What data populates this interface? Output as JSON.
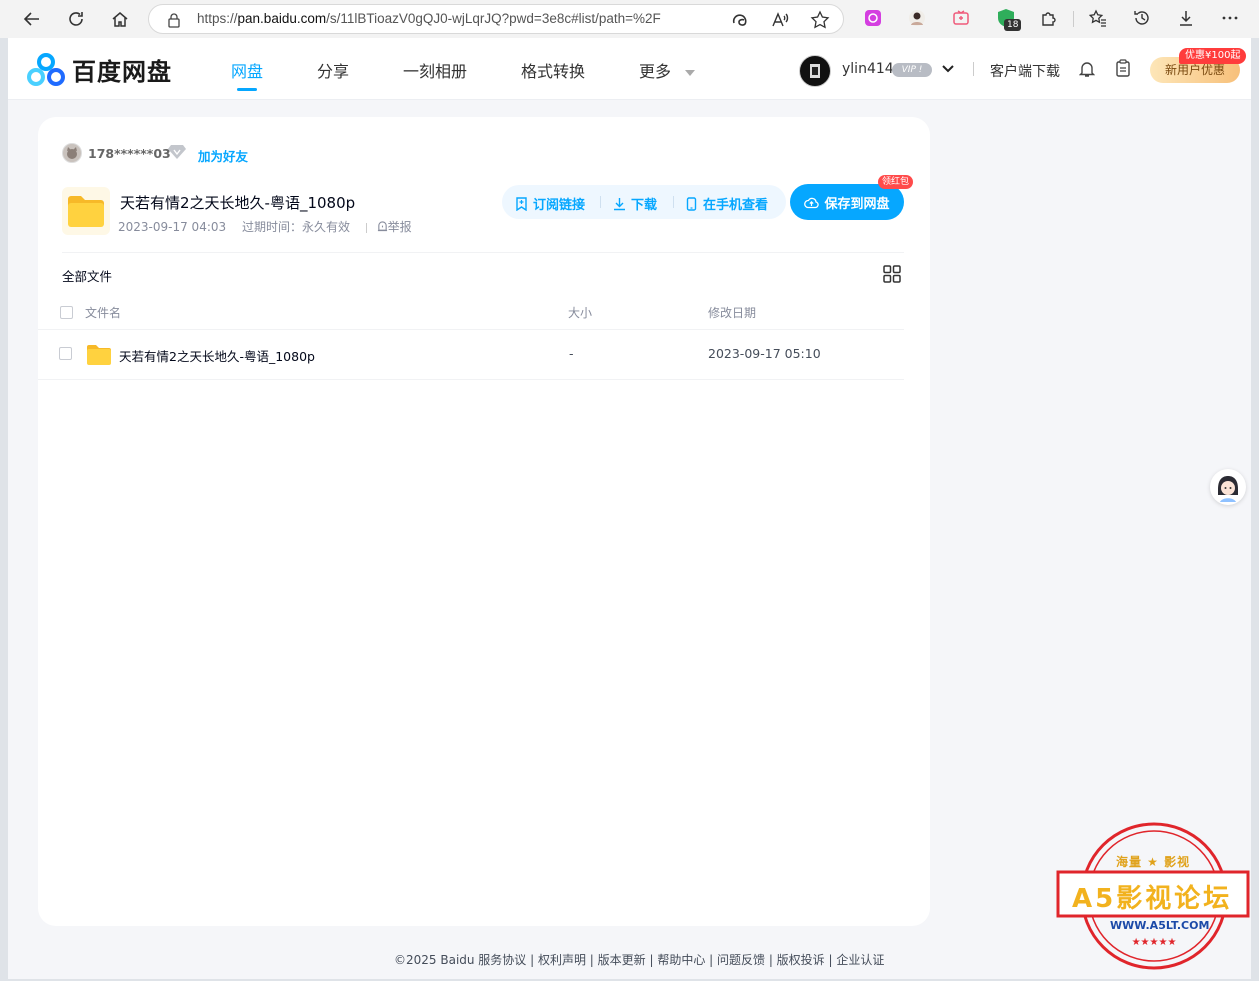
{
  "browser": {
    "url_prefix": "https://",
    "url_host": "pan.baidu.com",
    "url_rest": "/s/11lBTioazV0gQJ0-wjLqrJQ?pwd=3e8c#list/path=%2F",
    "ext_badge": "18"
  },
  "topnav": {
    "logo_text": "百度网盘",
    "items": [
      {
        "label": "网盘"
      },
      {
        "label": "分享"
      },
      {
        "label": "一刻相册"
      },
      {
        "label": "格式转换"
      },
      {
        "label": "更多"
      }
    ],
    "username": "ylin414",
    "vip": "VIP !",
    "client_download": "客户端下载",
    "promo_badge": "优惠¥100起",
    "promo_label": "新用户优惠"
  },
  "share": {
    "sharer": "178******03",
    "add_friend": "加为好友",
    "title": "天若有情2之天长地久-粤语_1080p",
    "created": "2023-09-17 04:03",
    "expire_label": "过期时间：",
    "expire_value": "永久有效",
    "report": "举报",
    "actions": {
      "subscribe": "订阅链接",
      "download": "下载",
      "phone": "在手机查看",
      "save": "保存到网盘",
      "redpack": "领红包"
    }
  },
  "files": {
    "breadcrumb": "全部文件",
    "columns": {
      "name": "文件名",
      "size": "大小",
      "modified": "修改日期"
    },
    "rows": [
      {
        "name": "天若有情2之天长地久-粤语_1080p",
        "size": "-",
        "modified": "2023-09-17 05:10"
      }
    ]
  },
  "footer": "©2025 Baidu  服务协议 | 权利声明 | 版本更新 | 帮助中心 | 问题反馈 | 版权投诉 | 企业认证",
  "watermark": {
    "top": "海量 ★ 影视",
    "main": "A5影视论坛",
    "url": "WWW.A5LT.COM"
  },
  "colors": {
    "accent": "#06a7ff",
    "stamp_red": "#e0252b",
    "folder_yellow": "#ffc933"
  }
}
